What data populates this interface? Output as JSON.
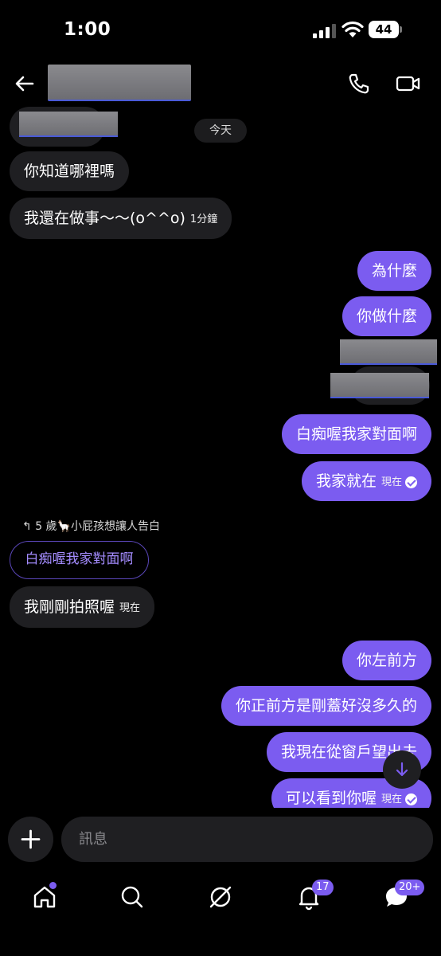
{
  "status_bar": {
    "time": "1:00",
    "battery": "44"
  },
  "header": {
    "back_icon": "arrow-left-icon",
    "call_icon": "phone-icon",
    "video_icon": "video-camera-icon"
  },
  "chat": {
    "date_label": "今天",
    "incoming_1": "你知道哪裡嗎",
    "incoming_2": "我還在做事～～(o^^o)",
    "incoming_2_time": "1分鐘",
    "outgoing_1": "為什麼",
    "outgoing_2": "你做什麼",
    "outgoing_3": "白痴喔我家對面啊",
    "outgoing_4": "我家就在",
    "outgoing_4_time": "現在",
    "reply_label": "5 歲🦙小屁孩想讓人告白",
    "reply_quote": "白痴喔我家對面啊",
    "incoming_3": "我剛剛拍照喔",
    "incoming_3_time": "現在",
    "outgoing_5": "你左前方",
    "outgoing_6": "你正前方是剛蓋好沒多久的",
    "outgoing_7": "我現在從窗戶望出去",
    "outgoing_8": "可以看到你喔",
    "outgoing_8_time": "現在"
  },
  "composer": {
    "placeholder": "訊息"
  },
  "tabbar": {
    "notifications_badge": "17",
    "messages_badge": "20+"
  },
  "colors": {
    "accent": "#7b5cf0",
    "incoming_bubble": "#1f1f22",
    "background": "#000000"
  }
}
